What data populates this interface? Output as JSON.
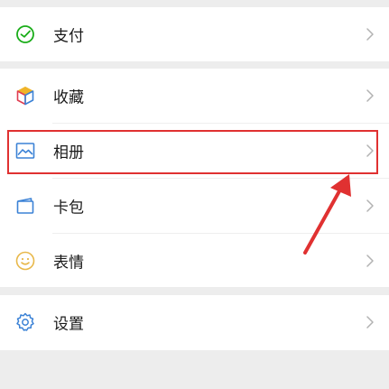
{
  "menu": {
    "pay": {
      "label": "支付",
      "icon": "pay-check-circle-icon"
    },
    "favorites": {
      "label": "收藏",
      "icon": "cube-box-icon"
    },
    "album": {
      "label": "相册",
      "icon": "picture-frame-icon"
    },
    "cards": {
      "label": "卡包",
      "icon": "card-wallet-icon"
    },
    "stickers": {
      "label": "表情",
      "icon": "smiley-face-icon"
    },
    "settings": {
      "label": "设置",
      "icon": "gear-icon"
    }
  },
  "annotation": {
    "highlighted_item": "album",
    "color": "#e03131"
  },
  "colors": {
    "background": "#ededed",
    "row_background": "#ffffff",
    "pay_green": "#1aad19",
    "blue_icon": "#3b82d6",
    "sticker_yellow": "#e8b84a"
  }
}
